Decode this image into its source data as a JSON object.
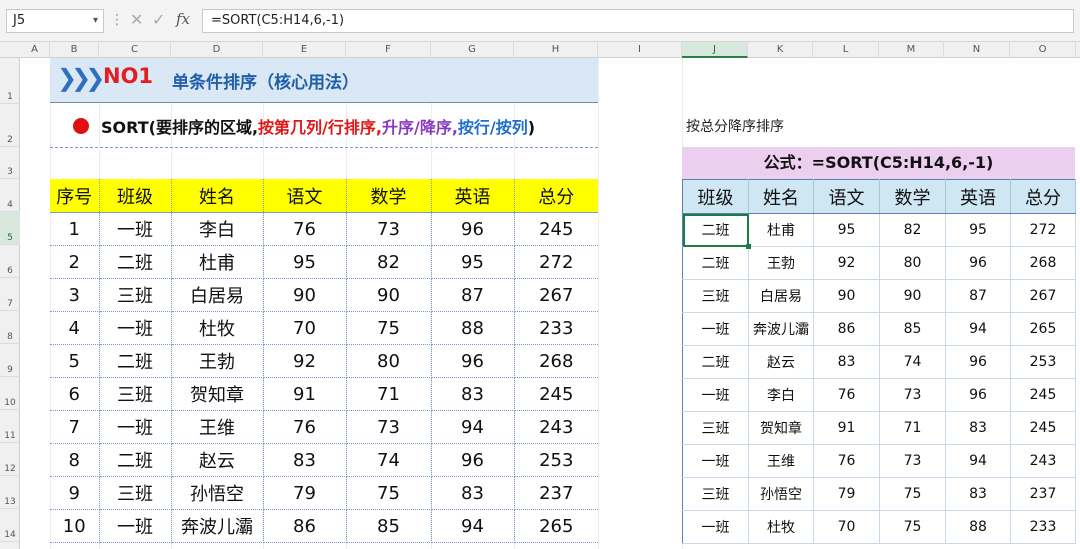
{
  "formula_bar": {
    "name_box": "J5",
    "formula": "=SORT(C5:H14,6,-1)"
  },
  "columns": [
    "A",
    "B",
    "C",
    "D",
    "E",
    "F",
    "G",
    "H",
    "I",
    "J",
    "K",
    "L",
    "M",
    "N",
    "O"
  ],
  "rows": [
    "1",
    "2",
    "3",
    "4",
    "5",
    "6",
    "7",
    "8",
    "9",
    "10",
    "11",
    "12",
    "13",
    "14"
  ],
  "title": {
    "chevron": "❯❯❯",
    "no": "NO1",
    "text": "单条件排序（核心用法）"
  },
  "syntax": {
    "p1": "SORT(要排序的区域,",
    "p2": "按第几列/行排序,",
    "p3": "升序/降序,",
    "p4": "按行/按列",
    "p5": ")"
  },
  "left_table": {
    "headers": [
      "序号",
      "班级",
      "姓名",
      "语文",
      "数学",
      "英语",
      "总分"
    ],
    "rows": [
      [
        "1",
        "一班",
        "李白",
        "76",
        "73",
        "96",
        "245"
      ],
      [
        "2",
        "二班",
        "杜甫",
        "95",
        "82",
        "95",
        "272"
      ],
      [
        "3",
        "三班",
        "白居易",
        "90",
        "90",
        "87",
        "267"
      ],
      [
        "4",
        "一班",
        "杜牧",
        "70",
        "75",
        "88",
        "233"
      ],
      [
        "5",
        "二班",
        "王勃",
        "92",
        "80",
        "96",
        "268"
      ],
      [
        "6",
        "三班",
        "贺知章",
        "91",
        "71",
        "83",
        "245"
      ],
      [
        "7",
        "一班",
        "王维",
        "76",
        "73",
        "94",
        "243"
      ],
      [
        "8",
        "二班",
        "赵云",
        "83",
        "74",
        "96",
        "253"
      ],
      [
        "9",
        "三班",
        "孙悟空",
        "79",
        "75",
        "83",
        "237"
      ],
      [
        "10",
        "一班",
        "奔波儿灞",
        "86",
        "85",
        "94",
        "265"
      ]
    ]
  },
  "right": {
    "caption": "按总分降序排序",
    "formula_label": "公式：=SORT(C5:H14,6,-1)",
    "headers": [
      "班级",
      "姓名",
      "语文",
      "数学",
      "英语",
      "总分"
    ],
    "rows": [
      [
        "二班",
        "杜甫",
        "95",
        "82",
        "95",
        "272"
      ],
      [
        "二班",
        "王勃",
        "92",
        "80",
        "96",
        "268"
      ],
      [
        "三班",
        "白居易",
        "90",
        "90",
        "87",
        "267"
      ],
      [
        "一班",
        "奔波儿灞",
        "86",
        "85",
        "94",
        "265"
      ],
      [
        "二班",
        "赵云",
        "83",
        "74",
        "96",
        "253"
      ],
      [
        "一班",
        "李白",
        "76",
        "73",
        "96",
        "245"
      ],
      [
        "三班",
        "贺知章",
        "91",
        "71",
        "83",
        "245"
      ],
      [
        "一班",
        "王维",
        "76",
        "73",
        "94",
        "243"
      ],
      [
        "三班",
        "孙悟空",
        "79",
        "75",
        "83",
        "237"
      ],
      [
        "一班",
        "杜牧",
        "70",
        "75",
        "88",
        "233"
      ]
    ]
  },
  "colors": {
    "header_yellow": "#ffff00",
    "header_blue": "#cfe6f3",
    "formula_band": "#eccfee",
    "title_band": "#dae7f5",
    "accent_red": "#e02020",
    "accent_blue": "#1f5fa8"
  }
}
